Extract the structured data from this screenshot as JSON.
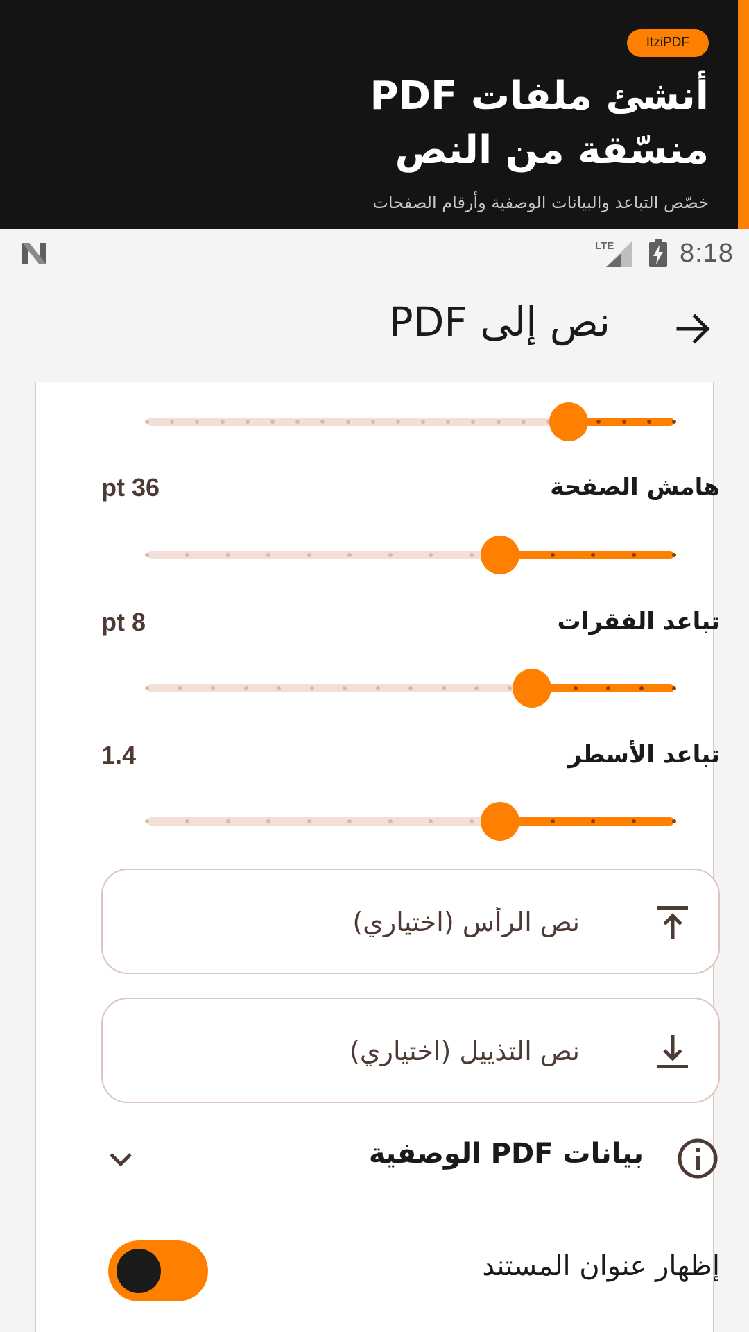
{
  "promo": {
    "badge": "ItziPDF",
    "title_line1": "أنشئ ملفات PDF",
    "title_line2": "منسّقة من النص",
    "subtitle": "خصّص التباعد والبيانات الوصفية وأرقام الصفحات"
  },
  "status_bar": {
    "left_icon": "n-notification-icon",
    "network": "LTE",
    "time": "8:18"
  },
  "app_bar": {
    "title": "نص إلى PDF",
    "back_icon": "arrow-right-icon"
  },
  "sliders": [
    {
      "id": "top",
      "label": "",
      "value_text": "",
      "position": 0.8,
      "steps": 21
    },
    {
      "id": "margin",
      "label": "هامش الصفحة",
      "value_text": "pt 36",
      "position": 0.67,
      "steps": 13
    },
    {
      "id": "paragraph",
      "label": "تباعد الفقرات",
      "value_text": "pt 8",
      "position": 0.73,
      "steps": 16
    },
    {
      "id": "line",
      "label": "تباعد الأسطر",
      "value_text": "1.4",
      "position": 0.67,
      "steps": 13
    }
  ],
  "fields": {
    "header_placeholder": "نص الرأس (اختياري)",
    "header_icon": "align-top-icon",
    "footer_placeholder": "نص التذييل (اختياري)",
    "footer_icon": "download-icon"
  },
  "metadata": {
    "title": "بيانات PDF الوصفية",
    "info_icon": "info-icon",
    "chevron_icon": "chevron-down-icon"
  },
  "toggle": {
    "label": "إظهار عنوان المستند",
    "checked": true
  },
  "colors": {
    "accent": "#FF8000",
    "dark": "#141414",
    "track": "#f3dfd8",
    "card_border": "#dcc9c2",
    "value_text": "#4e3a34"
  }
}
